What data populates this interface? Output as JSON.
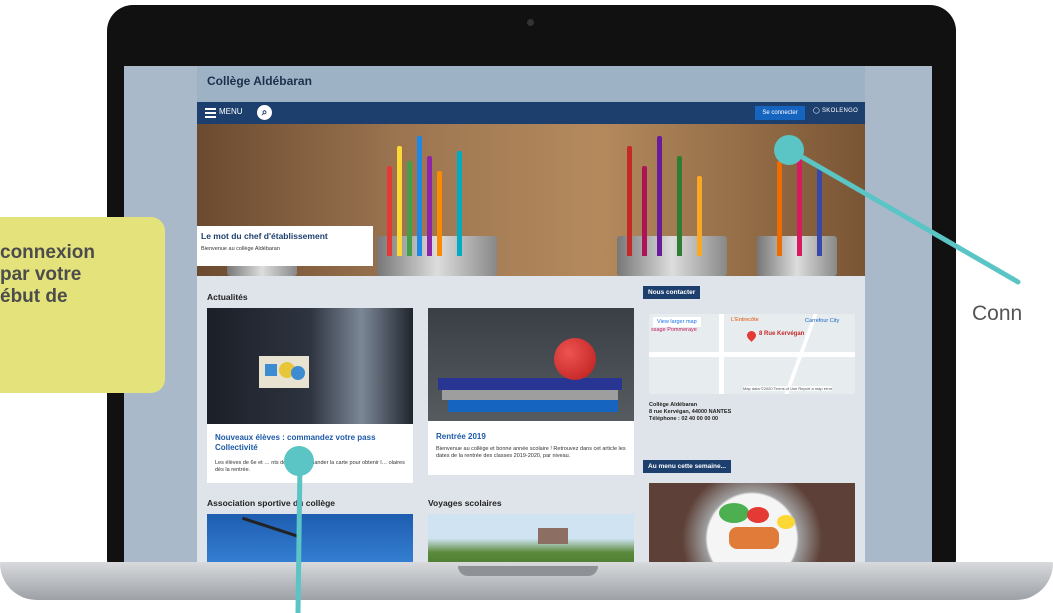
{
  "site": {
    "title": "Collège Aldébaran",
    "menu_label": "MENU",
    "connect_label": "Se connecter",
    "skolengo_label": "SKOLENGO"
  },
  "hero": {
    "title": "Le mot du chef d'établissement",
    "subtitle": "Bienvenue au collège Aldébaran"
  },
  "news": {
    "section_title": "Actualités",
    "cards": [
      {
        "title": "Nouveaux élèves : commandez votre pass Collectivité",
        "text": "Les élèves de 6e et … nts doivent commander la carte pour obtenir l… olaires dès la rentrée."
      },
      {
        "title": "Rentrée 2019",
        "text": "Bienvenue au collège et bonne année scolaire ! Retrouvez dans cet article les dates de la rentrée des classes 2019-2020, par niveau."
      }
    ],
    "section2_left": "Association sportive du collège",
    "section2_right": "Voyages scolaires"
  },
  "sidebar": {
    "contact_title": "Nous contacter",
    "map_button": "View larger map",
    "map_place_1": "L'Entrecôte",
    "map_place_2": "8 Rue Kervégan",
    "map_place_3": "Carrefour City",
    "map_place_4": "ssage Pommeraye",
    "map_footer": "Map data ©2020   Terms of Use   Report a map error",
    "address_name": "Collège Aldébaran",
    "address_line": "8 rue Kervégan, 44000 NANTES",
    "phone": "Téléphone : 02 40 00 00 00",
    "menu_title": "Au menu cette semaine..."
  },
  "annotations": {
    "left_callout": "connexion\npar votre\nébut de",
    "right_label": "Conn"
  },
  "colors": {
    "accent": "#5bc4c4",
    "navbar": "#1d3f6e",
    "callout": "#e4e27a"
  }
}
